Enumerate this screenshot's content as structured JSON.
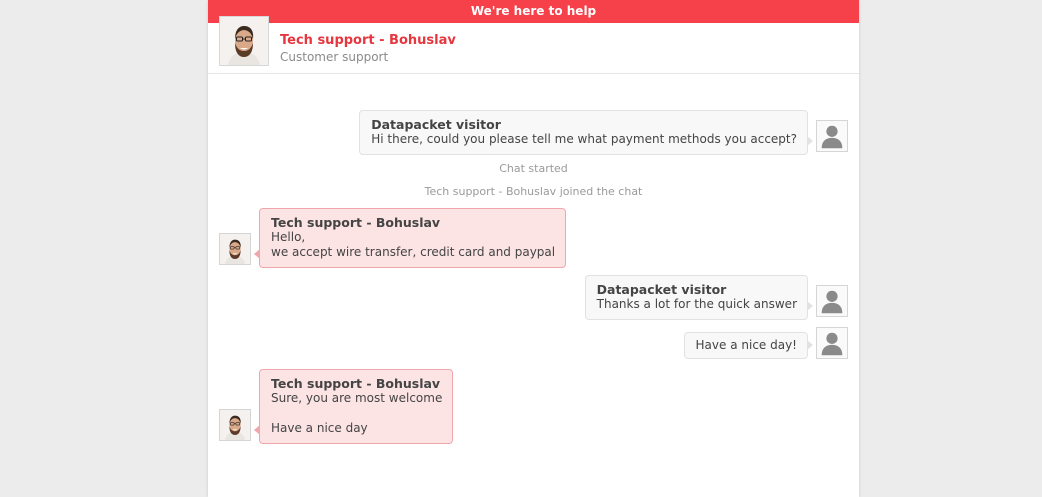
{
  "topbar": {
    "title": "We're here to help"
  },
  "header": {
    "agent_name": "Tech support - Bohuslav",
    "agent_role": "Customer support",
    "avatar_icon": "agent-photo-avatar"
  },
  "messages": [
    {
      "type": "visitor",
      "author": "Datapacket visitor",
      "lines": [
        "Hi there, could you please tell me what payment methods you accept?"
      ]
    },
    {
      "type": "system",
      "text": "Chat started"
    },
    {
      "type": "system",
      "text": "Tech support - Bohuslav joined the chat"
    },
    {
      "type": "agent",
      "author": "Tech support - Bohuslav",
      "lines": [
        "Hello,",
        "we accept wire transfer, credit card and paypal"
      ]
    },
    {
      "type": "visitor",
      "author": "Datapacket visitor",
      "lines": [
        "Thanks a lot for the quick answer"
      ]
    },
    {
      "type": "visitor",
      "author": "",
      "lines": [
        "Have a nice day!"
      ]
    },
    {
      "type": "agent",
      "author": "Tech support - Bohuslav",
      "lines": [
        "Sure, you are most welcome",
        "",
        "Have a nice day"
      ]
    }
  ],
  "colors": {
    "accent": "#f6404a",
    "agent_name": "#e8363f",
    "agent_bubble": "#fce3e4",
    "visitor_bubble": "#f8f8f8",
    "page_bg": "#ececec"
  },
  "icons": {
    "visitor_avatar": "user-silhouette-icon",
    "agent_avatar": "agent-photo-avatar"
  }
}
